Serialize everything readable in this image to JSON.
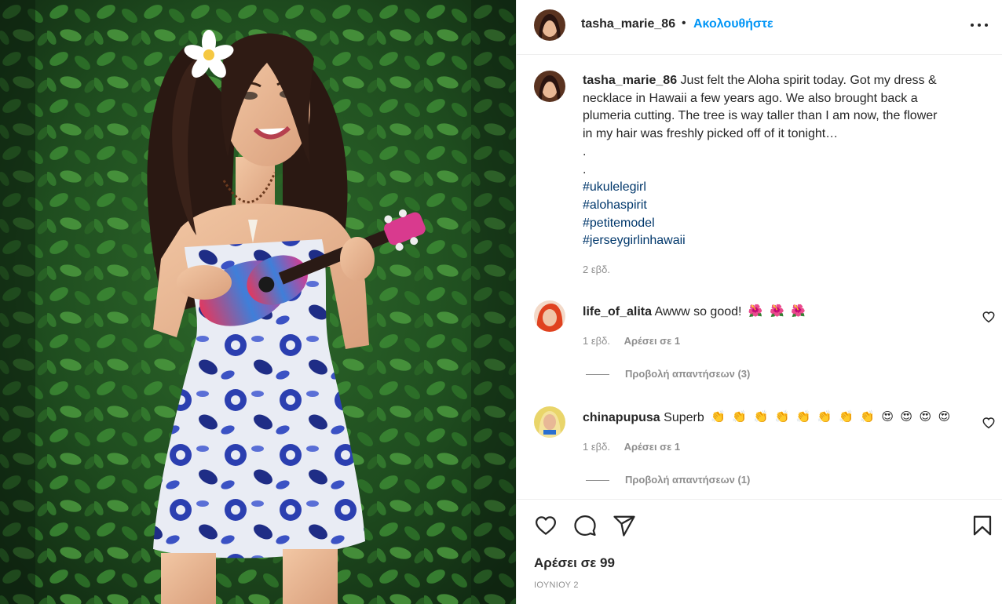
{
  "post": {
    "author": "tasha_marie_86",
    "separator": "•",
    "follow_label": "Ακολουθήστε",
    "more_icon": "more-options-icon",
    "photo_description_icon": "post-photo",
    "caption": {
      "lines": [
        "Just felt the Aloha spirit today. Got my dress &",
        "necklace in Hawaii a few years ago. We also brought back a",
        "plumeria cutting. The tree is way taller than I am now, the flower",
        "in my hair was freshly picked off of it tonight…",
        ".",
        "."
      ],
      "hashtags": [
        "#ukulelegirl",
        "#alohaspirit",
        "#petitemodel",
        "#jerseygirlinhawaii"
      ],
      "time": "2 εβδ."
    },
    "likes_text": "Αρέσει σε 99",
    "date": "ΙΟΥΝΙΟΥ 2"
  },
  "comments": [
    {
      "username": "life_of_alita",
      "text": "Awww so good!",
      "emojis": [
        "🌺",
        "🌺",
        "🌺"
      ],
      "time": "1 εβδ.",
      "likes": "Αρέσει σε 1",
      "replies": "Προβολή απαντήσεων (3)"
    },
    {
      "username": "chinapupusa",
      "text": "Superb",
      "emojis": [
        "👏",
        "👏",
        "👏",
        "👏",
        "👏",
        "👏",
        "👏",
        "👏",
        "😍",
        "😍",
        "😍",
        "😍"
      ],
      "time": "1 εβδ.",
      "likes": "Αρέσει σε 1",
      "replies": "Προβολή απαντήσεων (1)"
    }
  ],
  "icons": {
    "like": "heart-icon",
    "comment": "comment-icon",
    "share": "paper-plane-icon",
    "save": "bookmark-icon"
  },
  "colors": {
    "follow_blue": "#0095f6",
    "hashtag_blue": "#00376b",
    "muted_gray": "#8e8e8e",
    "text_dark": "#262626",
    "border": "#efefef"
  }
}
